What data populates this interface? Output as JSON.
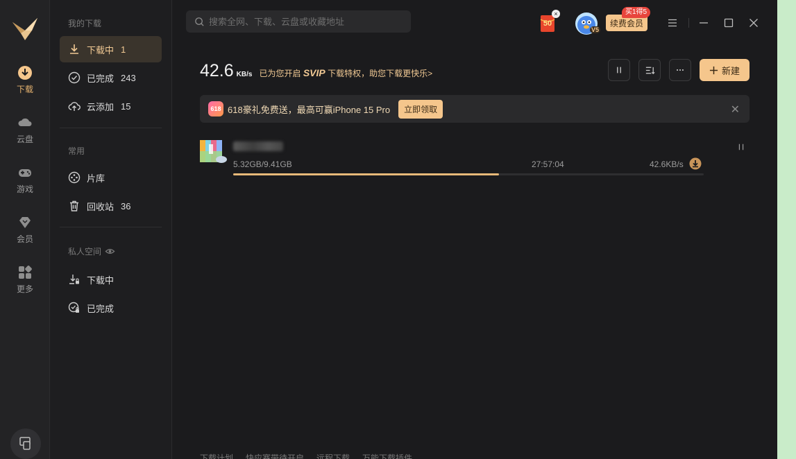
{
  "rail": {
    "items": [
      {
        "label": "下载"
      },
      {
        "label": "云盘"
      },
      {
        "label": "游戏"
      },
      {
        "label": "会员"
      },
      {
        "label": "更多"
      }
    ]
  },
  "sidebar": {
    "my_downloads_title": "我的下载",
    "downloading": {
      "label": "下载中",
      "count": "1"
    },
    "completed": {
      "label": "已完成",
      "count": "243"
    },
    "cloud_added": {
      "label": "云添加",
      "count": "15"
    },
    "common_title": "常用",
    "library": {
      "label": "片库"
    },
    "recycle": {
      "label": "回收站",
      "count": "36"
    },
    "private_title": "私人空间",
    "private_downloading": {
      "label": "下载中"
    },
    "private_completed": {
      "label": "已完成"
    }
  },
  "search": {
    "placeholder": "搜索全网、下载、云盘或收藏地址"
  },
  "header": {
    "gift_badge": "50",
    "vip_level": "V5",
    "renew_label": "续费会员",
    "renew_tag": "买1得5"
  },
  "speed": {
    "value": "42.6",
    "unit": "KB/s",
    "promo_prefix": "已为您开启",
    "promo_svip": "SVIP",
    "promo_suffix": "下载特权，助您下载更快乐>"
  },
  "toolbar": {
    "new_label": "新建"
  },
  "banner": {
    "badge": "618",
    "text": "618豪礼免费送，最高可赢iPhone 15 Pro",
    "claim_label": "立即领取"
  },
  "task": {
    "size": "5.32GB/9.41GB",
    "eta": "27:57:04",
    "speed": "42.6KB/s",
    "progress": 0.565
  },
  "footer": {
    "items": [
      "下载计划",
      "快应赛带待开启",
      "远程下载",
      "万能下载插件"
    ]
  },
  "colors": {
    "accent": "#f5c68c",
    "background": "#1b1b1d",
    "progress": "#e8b979"
  }
}
